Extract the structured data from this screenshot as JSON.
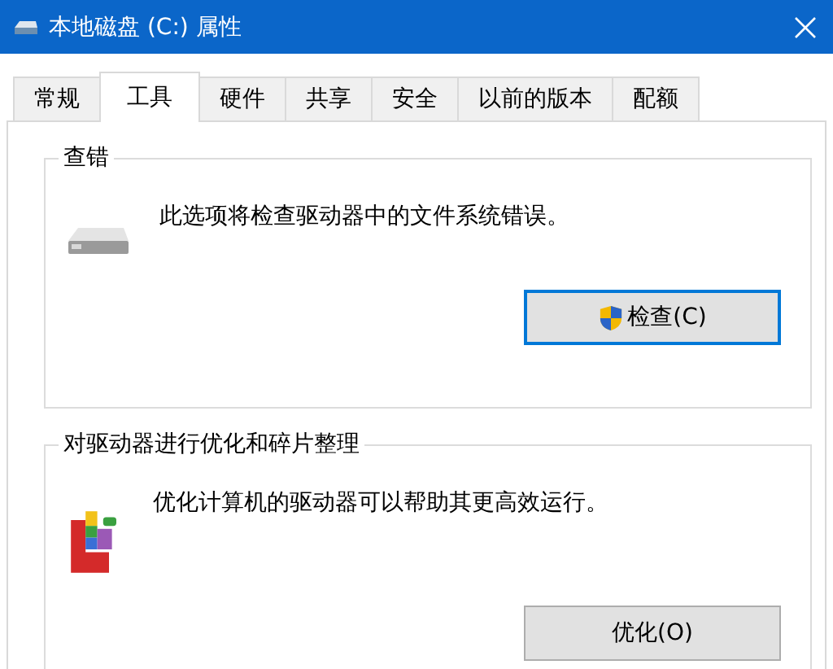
{
  "window": {
    "title": "本地磁盘 (C:) 属性"
  },
  "tabs": [
    {
      "label": "常规",
      "selected": false
    },
    {
      "label": "工具",
      "selected": true
    },
    {
      "label": "硬件",
      "selected": false
    },
    {
      "label": "共享",
      "selected": false
    },
    {
      "label": "安全",
      "selected": false
    },
    {
      "label": "以前的版本",
      "selected": false
    },
    {
      "label": "配额",
      "selected": false
    }
  ],
  "groups": [
    {
      "title": "查错",
      "kind": "drive",
      "description": "此选项将检查驱动器中的文件系统错误。",
      "button": {
        "label": "检查(C)",
        "shield": true,
        "focused": true
      }
    },
    {
      "title": "对驱动器进行优化和碎片整理",
      "kind": "defrag",
      "description": "优化计算机的驱动器可以帮助其更高效运行。",
      "button": {
        "label": "优化(O)",
        "shield": false,
        "focused": false
      }
    }
  ]
}
